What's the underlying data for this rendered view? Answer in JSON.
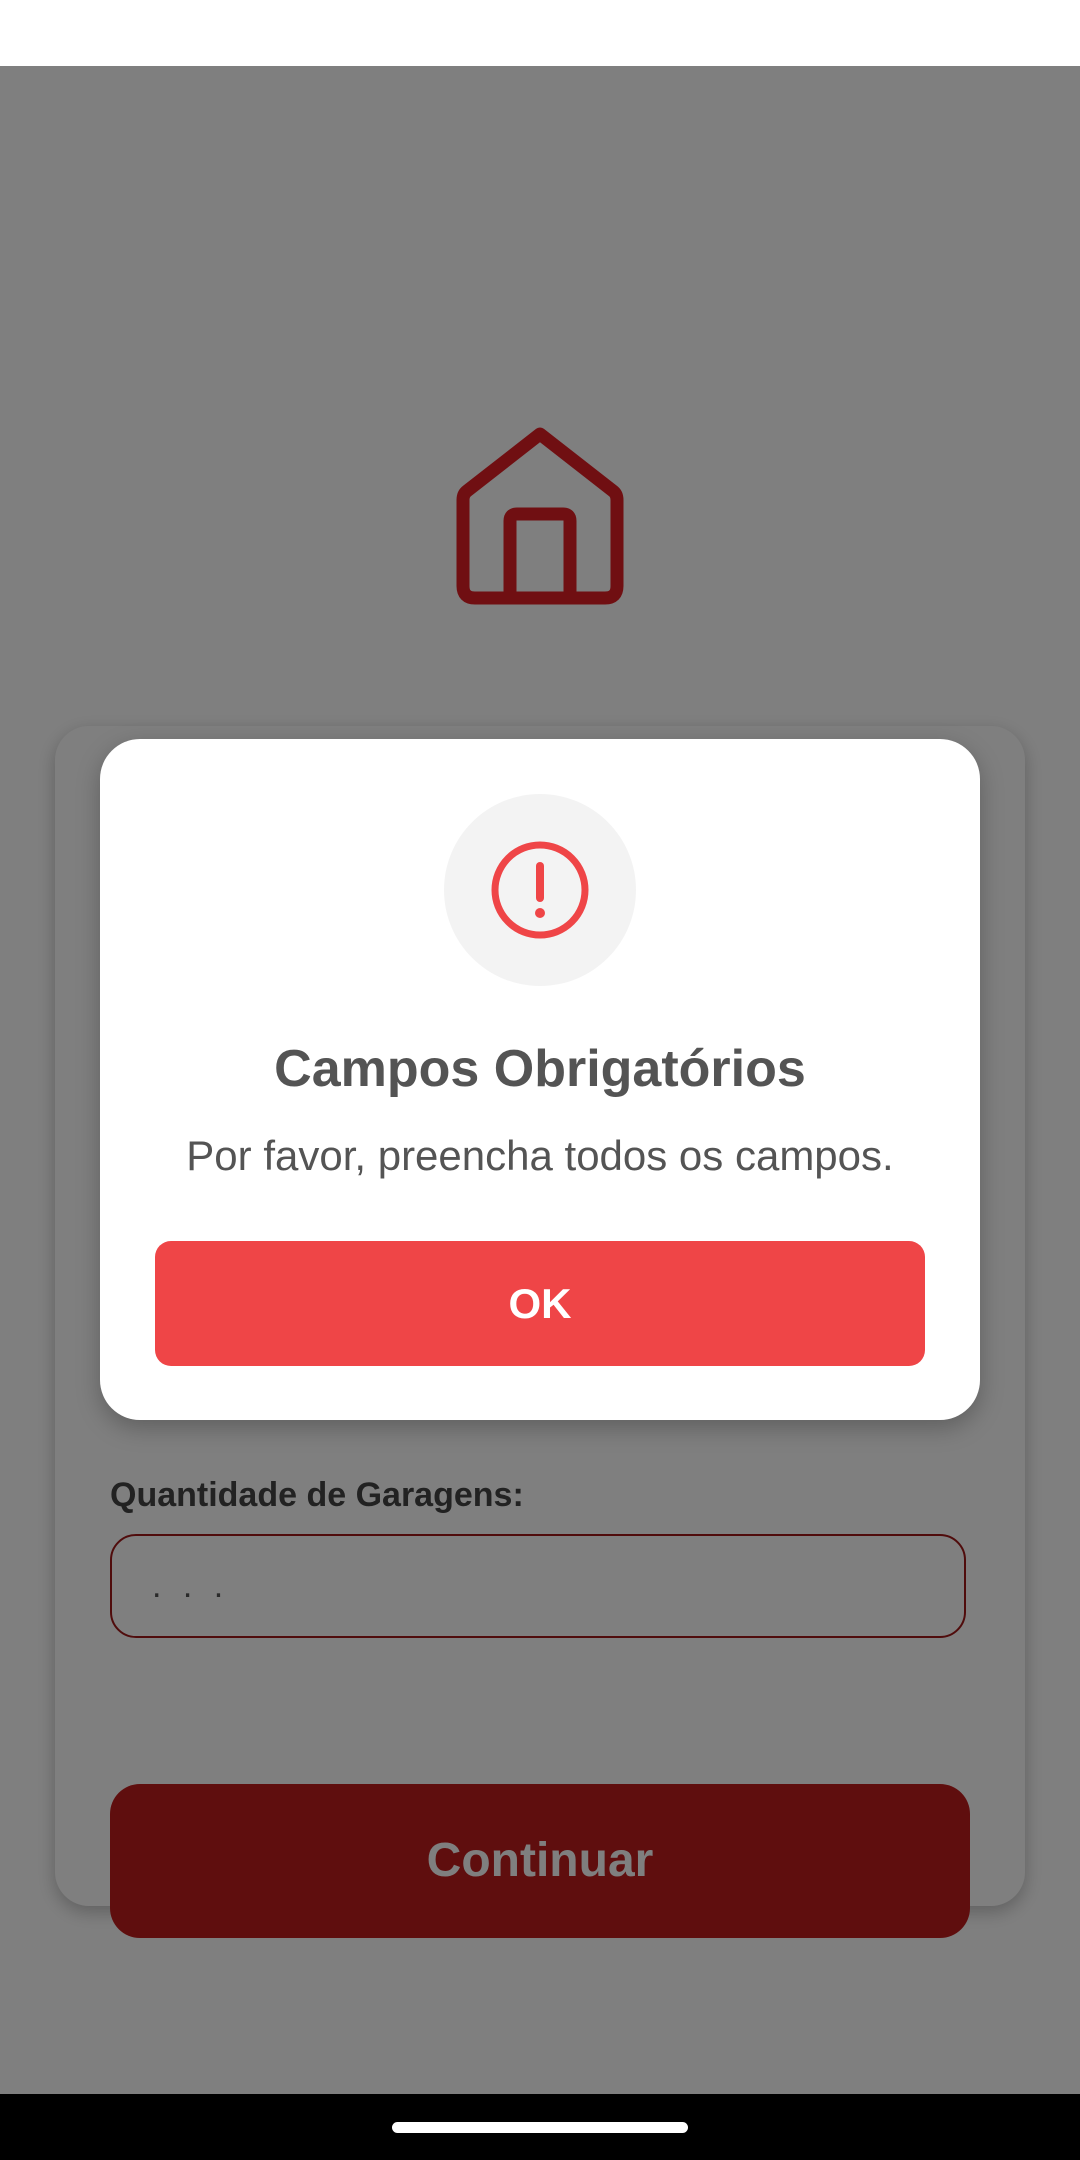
{
  "form": {
    "garage_label": "Quantidade de Garagens:",
    "garage_placeholder": ". . .",
    "continue_label": "Continuar"
  },
  "dialog": {
    "icon": "exclamation-circle-icon",
    "title": "Campos Obrigatórios",
    "message": "Por favor, preencha todos os campos.",
    "ok_label": "OK"
  },
  "colors": {
    "brand_dark_red": "#bf1c1c",
    "alert_red": "#ef4547",
    "scrim": "rgba(0,0,0,0.5)"
  }
}
